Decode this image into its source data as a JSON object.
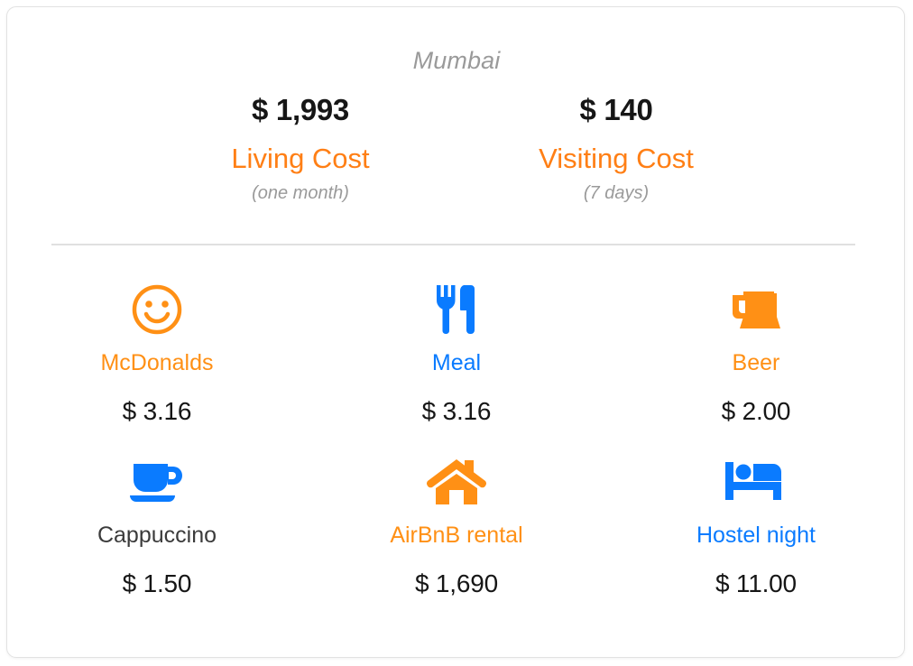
{
  "colors": {
    "orange_strong": "#ff7f15",
    "orange": "#ff9015",
    "blue": "#0a7bff",
    "dark": "#3b3b3b",
    "muted": "#9a9a9a",
    "price": "#161616",
    "card_border": "#e2e2e2",
    "divider": "#e0e0e0"
  },
  "header": {
    "city": "Mumbai",
    "summaries": [
      {
        "amount": "$ 1,993",
        "label": "Living Cost",
        "sub": "(one month)"
      },
      {
        "amount": "$ 140",
        "label": "Visiting Cost",
        "sub": "(7 days)"
      }
    ]
  },
  "items": [
    {
      "icon": "smiley-face-icon",
      "label": "McDonalds",
      "price": "$ 3.16",
      "label_color": "orange"
    },
    {
      "icon": "fork-and-knife-icon",
      "label": "Meal",
      "price": "$ 3.16",
      "label_color": "blue"
    },
    {
      "icon": "beer-mug-icon",
      "label": "Beer",
      "price": "$ 2.00",
      "label_color": "orange"
    },
    {
      "icon": "coffee-cup-icon",
      "label": "Cappuccino",
      "price": "$ 1.50",
      "label_color": "dark"
    },
    {
      "icon": "house-icon",
      "label": "AirBnB rental",
      "price": "$ 1,690",
      "label_color": "orange"
    },
    {
      "icon": "bed-icon",
      "label": "Hostel night",
      "price": "$ 11.00",
      "label_color": "blue"
    }
  ]
}
